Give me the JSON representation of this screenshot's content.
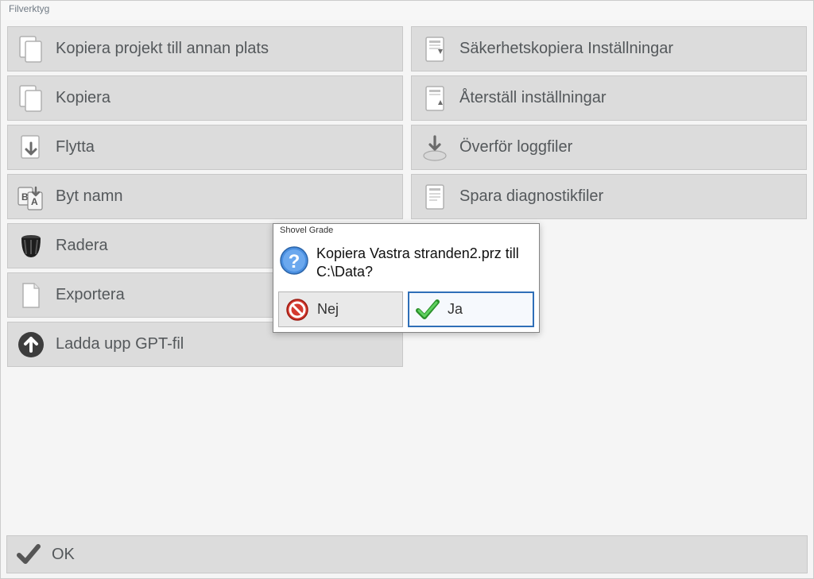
{
  "window_title": "Filverktyg",
  "left_buttons": {
    "copy_project": "Kopiera projekt till annan plats",
    "copy": "Kopiera",
    "move": "Flytta",
    "rename": "Byt namn",
    "delete": "Radera",
    "export": "Exportera",
    "upload_gpt": "Ladda upp GPT-fil"
  },
  "right_buttons": {
    "backup_settings": "Säkerhetskopiera Inställningar",
    "restore_settings": "Återställ inställningar",
    "transfer_logs": "Överför loggfiler",
    "save_diag": "Spara diagnostikfiler"
  },
  "footer": {
    "ok": "OK"
  },
  "dialog": {
    "title": "Shovel Grade",
    "message": "Kopiera Vastra stranden2.prz till C:\\Data?",
    "no": "Nej",
    "yes": "Ja"
  }
}
